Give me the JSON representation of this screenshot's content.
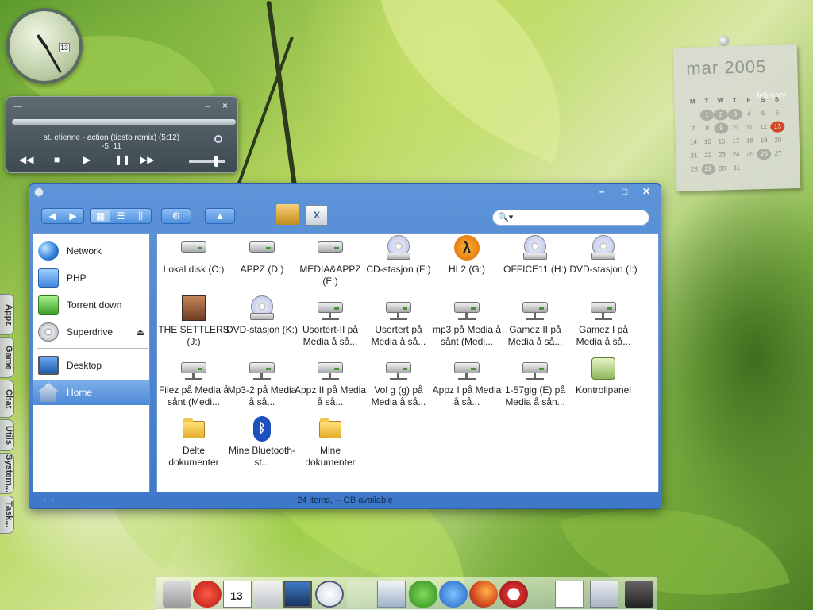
{
  "clock": {
    "date": "13"
  },
  "player": {
    "track": "st. etienne - action (tiesto remix) (5:12)",
    "time": "-5: 11",
    "minimize": "–",
    "close": "×",
    "menu": "—",
    "controls": {
      "rewind": "◀◀",
      "stop": "■",
      "play": "▶",
      "pause": "❚❚",
      "forward": "▶▶"
    }
  },
  "calendar": {
    "title": "mar 2005",
    "month_name": "february",
    "headers": [
      "M",
      "T",
      "W",
      "T",
      "F",
      "S",
      "S"
    ],
    "weeks": [
      [
        "",
        "1",
        "2",
        "3",
        "4",
        "5",
        "6"
      ],
      [
        "7",
        "8",
        "9",
        "10",
        "11",
        "12",
        "13"
      ],
      [
        "14",
        "15",
        "16",
        "17",
        "18",
        "19",
        "20"
      ],
      [
        "21",
        "22",
        "23",
        "24",
        "25",
        "26",
        "27"
      ],
      [
        "28",
        "29",
        "30",
        "31",
        "",
        "",
        ""
      ]
    ],
    "marked": [
      "1",
      "2",
      "3",
      "9",
      "26",
      "29"
    ],
    "today": "13"
  },
  "side_tabs": [
    "Appz",
    "Game",
    "Chat",
    "Utils",
    "System...",
    "Task..."
  ],
  "window": {
    "buttons": {
      "minimize": "–",
      "maximize": "□",
      "close": "✕"
    },
    "toolbar": {
      "back": "◀",
      "forward": "▶",
      "view_icons": "▦",
      "view_list": "☰",
      "view_columns": "⫼",
      "action": "⚙",
      "eject": "▲",
      "search_glyph": "🔍▾"
    },
    "sidebar": {
      "items": [
        {
          "label": "Network",
          "icon": "globe-icon"
        },
        {
          "label": "PHP",
          "icon": "drive-icon"
        },
        {
          "label": "Torrent down",
          "icon": "drive-green-icon"
        },
        {
          "label": "Superdrive",
          "icon": "cd-icon",
          "eject": "⏏"
        },
        {
          "label": "Desktop",
          "icon": "desktop-icon"
        },
        {
          "label": "Home",
          "icon": "home-icon"
        }
      ]
    },
    "items": [
      {
        "label": "Lokal disk (C:)",
        "icon": "drive"
      },
      {
        "label": "APPZ (D:)",
        "icon": "drive"
      },
      {
        "label": "MEDIA&APPZ (E:)",
        "icon": "drive"
      },
      {
        "label": "CD-stasjon (F:)",
        "icon": "disc"
      },
      {
        "label": "HL2 (G:)",
        "icon": "hl2"
      },
      {
        "label": "OFFICE11 (H:)",
        "icon": "disc"
      },
      {
        "label": "DVD-stasjon (I:)",
        "icon": "disc"
      },
      {
        "label": "THE SETTLERS (J:)",
        "icon": "face"
      },
      {
        "label": "DVD-stasjon (K:)",
        "icon": "disc"
      },
      {
        "label": "Usortert-II på Media å så...",
        "icon": "net"
      },
      {
        "label": "Usortert på Media å så...",
        "icon": "net"
      },
      {
        "label": "mp3 på Media å sånt (Medi...",
        "icon": "net"
      },
      {
        "label": "Gamez II på Media å så...",
        "icon": "net"
      },
      {
        "label": "Gamez I på Media å så...",
        "icon": "net"
      },
      {
        "label": "Filez på Media å sånt (Medi...",
        "icon": "net"
      },
      {
        "label": "Mp3-2 på Media å så...",
        "icon": "net"
      },
      {
        "label": "Appz II på Media å så...",
        "icon": "net"
      },
      {
        "label": "Vol g (g) på Media å så...",
        "icon": "net"
      },
      {
        "label": "Appz I på Media å så...",
        "icon": "net"
      },
      {
        "label": "1-57gig (E) på Media å sån...",
        "icon": "net"
      },
      {
        "label": "Kontrollpanel",
        "icon": "cpanel"
      },
      {
        "label": "Delte dokumenter",
        "icon": "folder"
      },
      {
        "label": "Mine Bluetooth-st...",
        "icon": "bt"
      },
      {
        "label": "Mine dokumenter",
        "icon": "folder"
      }
    ],
    "status": "24 items, -- GB available"
  },
  "dock": {
    "apps": [
      "finder-icon",
      "power-icon",
      "calendar-icon",
      "trash-icon",
      "monitor-icon",
      "clock-icon",
      "blank-icon",
      "mail-icon",
      "messenger-icon",
      "ie-icon",
      "firefox-icon",
      "opera-icon",
      "document-icon",
      "app-icon",
      "laptop-icon"
    ],
    "calendar_day": "13"
  },
  "colors": {
    "accent": "#4e88d6",
    "today": "#d53c1e"
  }
}
